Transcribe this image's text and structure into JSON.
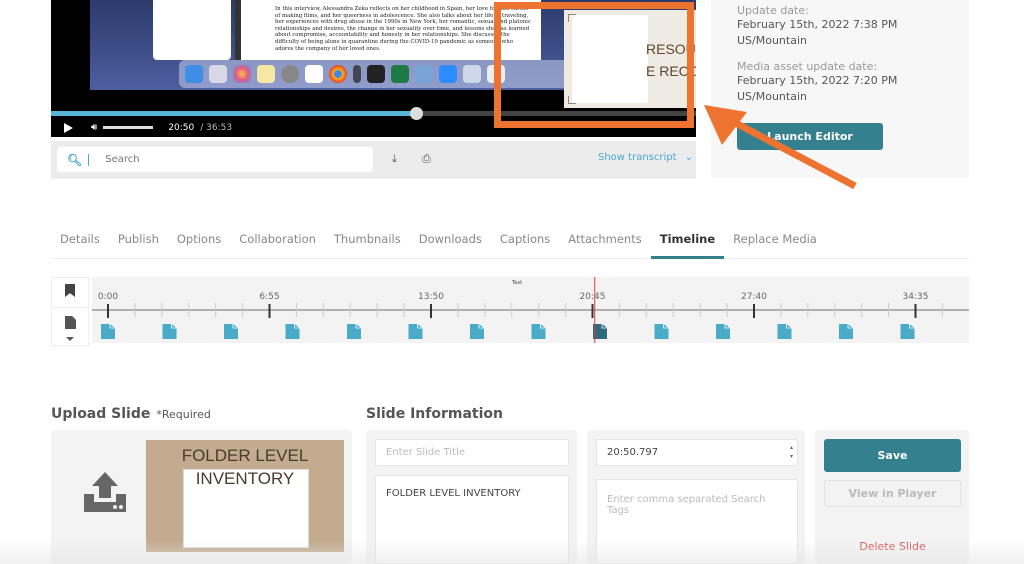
{
  "player": {
    "description_text": "In this interview, Alessandra Zeka reflects on her childhood in Spain, her love for and career of making films, and her queerness in adolescence. She also talks about her life of traveling, her experiences with drug abuse in the 1990s in New York, her romantic, sexual and platonic relationships and desires, the change in her sexuality over time, and lessons she has learned about compromise, accountability and honesty in her relationships. She discusses the difficulty of being alone in quarantine during the COVID-19 pandemic as someone who adores the company of her loved ones.",
    "current_time": "20:50",
    "total_time": "/ 36:53",
    "progress_fraction": 0.566,
    "preview_text_line1": "RESOURC",
    "preview_text_line2": "E RECORD"
  },
  "transcript_bar": {
    "search_placeholder": "Search",
    "show_transcript_label": "Show transcript",
    "chevron": "⌄"
  },
  "info_panel": {
    "update_label": "Update date:",
    "update_value_line1": "February 15th, 2022 7:38 PM",
    "update_value_line2": "US/Mountain",
    "media_update_label": "Media asset update date:",
    "media_update_value_line1": "February 15th, 2022 7:20 PM",
    "media_update_value_line2": "US/Mountain",
    "launch_editor_label": "Launch Editor"
  },
  "tabs": [
    {
      "label": "Details",
      "active": false
    },
    {
      "label": "Publish",
      "active": false
    },
    {
      "label": "Options",
      "active": false
    },
    {
      "label": "Collaboration",
      "active": false
    },
    {
      "label": "Thumbnails",
      "active": false
    },
    {
      "label": "Downloads",
      "active": false
    },
    {
      "label": "Captions",
      "active": false
    },
    {
      "label": "Attachments",
      "active": false
    },
    {
      "label": "Timeline",
      "active": true
    },
    {
      "label": "Replace Media",
      "active": false
    }
  ],
  "timeline": {
    "track_label": "Text",
    "tick_labels": [
      "0:00",
      "6:55",
      "13:50",
      "20:45",
      "27:40",
      "34:35"
    ],
    "duration_seconds": 2213,
    "playhead_seconds": 1250.797,
    "slide_count": 14,
    "active_slide_index": 8,
    "colors": {
      "slide": "#4aabc9",
      "slide_active": "#2e6b7e",
      "playhead": "#e53935"
    }
  },
  "upload": {
    "title": "Upload Slide",
    "required_label": "*Required",
    "preview_title_line1": "FOLDER LEVEL",
    "preview_title_line2": "INVENTORY"
  },
  "slide_info": {
    "title": "Slide Information",
    "title_placeholder": "Enter Slide Title",
    "description_value": "FOLDER LEVEL INVENTORY",
    "time_value": "20:50.797",
    "tags_placeholder": "Enter comma separated Search Tags"
  },
  "actions": {
    "save_label": "Save",
    "view_label": "View in Player",
    "delete_label": "Delete Slide"
  },
  "annotation": {
    "highlight_color": "#ee7330"
  }
}
